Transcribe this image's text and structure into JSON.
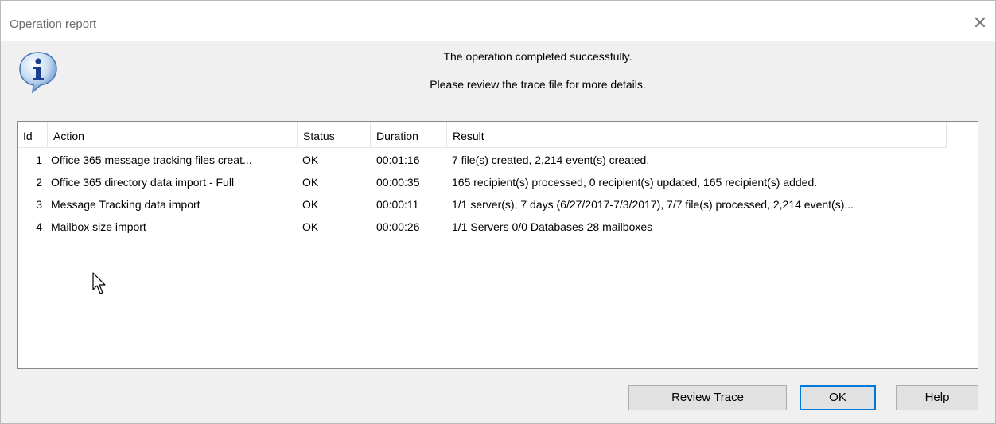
{
  "window": {
    "title": "Operation report",
    "close_glyph": "✕"
  },
  "message": {
    "line1": "The operation completed successfully.",
    "line2": "Please review the trace file for more details.",
    "icon": "info-icon"
  },
  "table": {
    "columns": [
      "Id",
      "Action",
      "Status",
      "Duration",
      "Result"
    ],
    "rows": [
      {
        "id": "1",
        "action": "Office 365 message tracking files creat...",
        "status": "OK",
        "duration": "00:01:16",
        "result": "7 file(s) created, 2,214 event(s) created."
      },
      {
        "id": "2",
        "action": "Office 365 directory data import - Full",
        "status": "OK",
        "duration": "00:00:35",
        "result": "165 recipient(s) processed, 0 recipient(s) updated, 165 recipient(s) added."
      },
      {
        "id": "3",
        "action": "Message Tracking data import",
        "status": "OK",
        "duration": "00:00:11",
        "result": "1/1 server(s), 7 days (6/27/2017-7/3/2017), 7/7 file(s) processed, 2,214 event(s)..."
      },
      {
        "id": "4",
        "action": "Mailbox size import",
        "status": "OK",
        "duration": "00:00:26",
        "result": "1/1 Servers 0/0 Databases 28 mailboxes"
      }
    ]
  },
  "buttons": {
    "review_trace": "Review Trace",
    "ok": "OK",
    "help": "Help"
  },
  "colors": {
    "accent": "#0078d7",
    "dialog_bg": "#f0f0f0"
  }
}
